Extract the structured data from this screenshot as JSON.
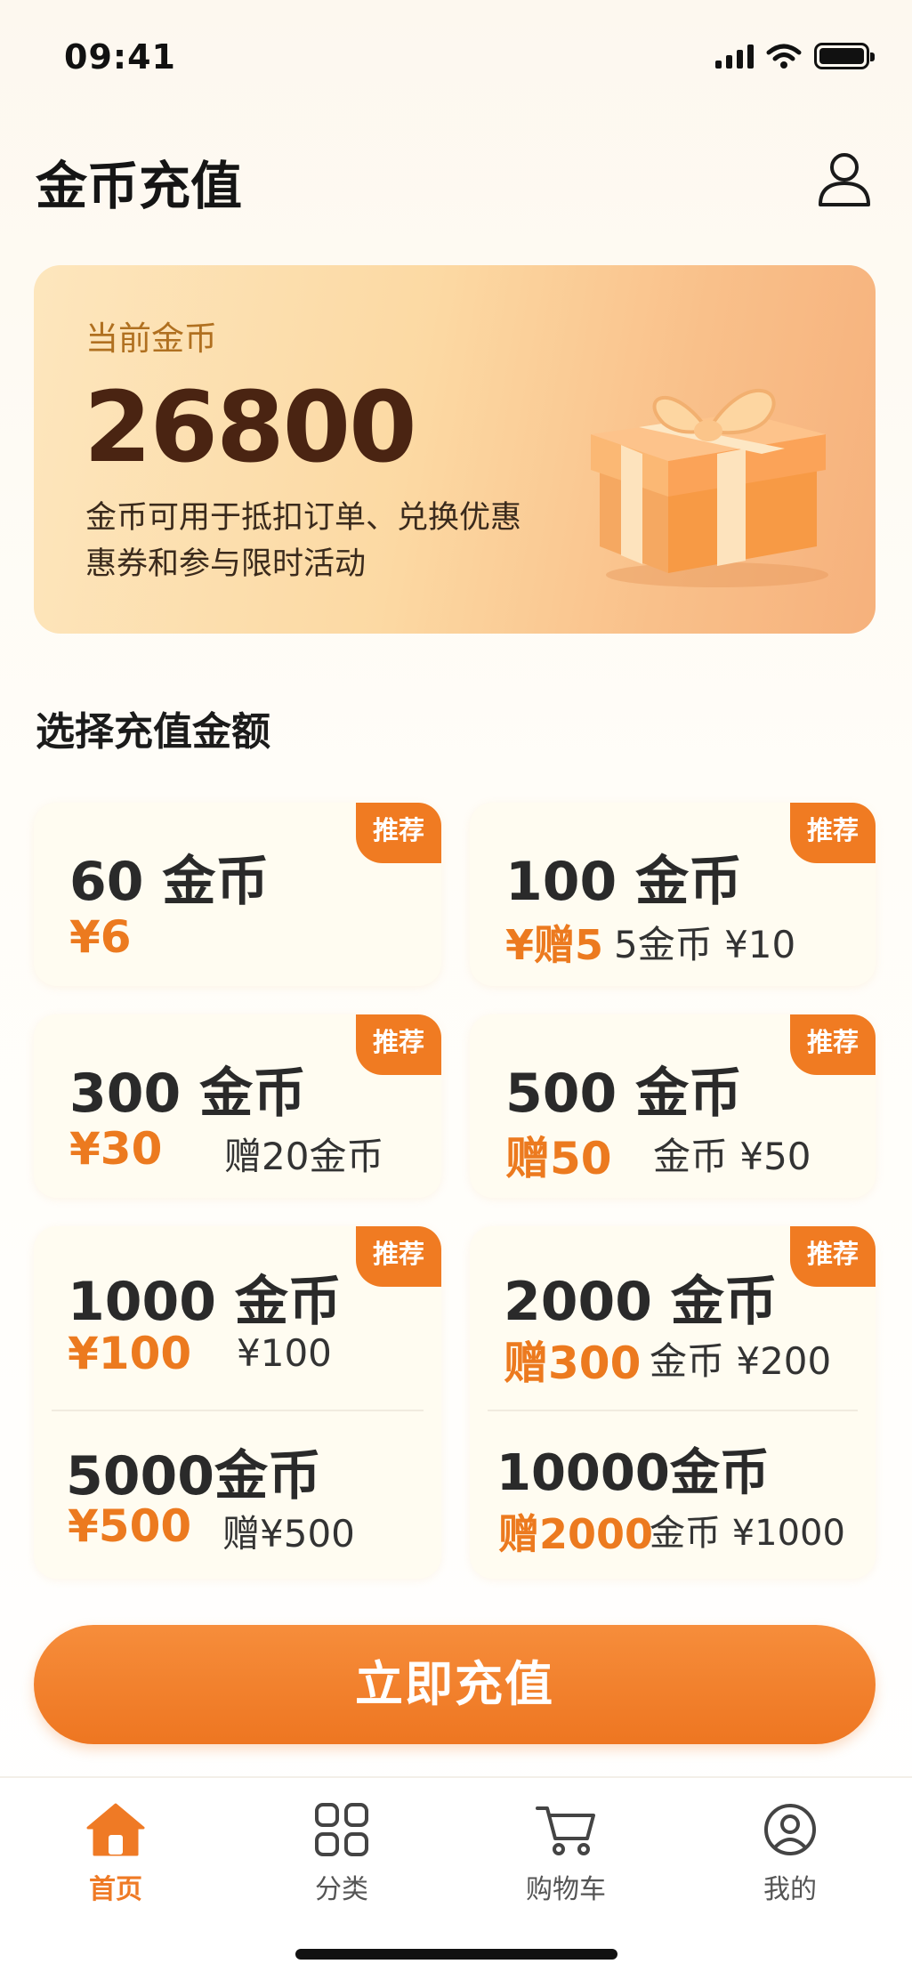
{
  "status": {
    "time": "09:41"
  },
  "header": {
    "title": "金币充值"
  },
  "balance": {
    "label": "当前金币",
    "value": "26800",
    "desc_line1": "金币可用于抵扣订单、兑换优惠",
    "desc_line2": "惠券和参与限时活动"
  },
  "section": {
    "title": "选择充值金额"
  },
  "packages": [
    {
      "tag": "推荐",
      "coins": "60 金币",
      "price": "¥6",
      "sub": ""
    },
    {
      "tag": "推荐",
      "coins": "100 金币",
      "price": "¥赠5",
      "sub": "5金币 ¥10"
    },
    {
      "tag": "推荐",
      "coins": "300 金币",
      "price": "¥30",
      "sub": "赠20金币"
    },
    {
      "tag": "推荐",
      "coins": "500 金币",
      "price": "赠50",
      "sub": "金币 ¥50"
    },
    {
      "tag": "推荐",
      "coins": "1000 金币",
      "price": "¥100",
      "sub": "¥100"
    },
    {
      "tag": "推荐",
      "coins": "2000 金币",
      "price": "赠300",
      "sub": "金币 ¥200"
    },
    {
      "tag": "",
      "coins": "5000金币",
      "price": "¥500",
      "sub": "赠¥500"
    },
    {
      "tag": "",
      "coins": "10000金币",
      "price": "赠2000",
      "sub": "金币 ¥1000"
    }
  ],
  "cta": {
    "label": "立即充值"
  },
  "tabbar": {
    "items": [
      {
        "label": "首页",
        "icon": "home-icon",
        "active": true
      },
      {
        "label": "分类",
        "icon": "grid-icon",
        "active": false
      },
      {
        "label": "购物车",
        "icon": "cart-icon",
        "active": false
      },
      {
        "label": "我的",
        "icon": "profile-icon",
        "active": false
      }
    ]
  },
  "colors": {
    "accent": "#ef7a25",
    "tag": "#f07b22",
    "balance_text": "#4a2412"
  }
}
